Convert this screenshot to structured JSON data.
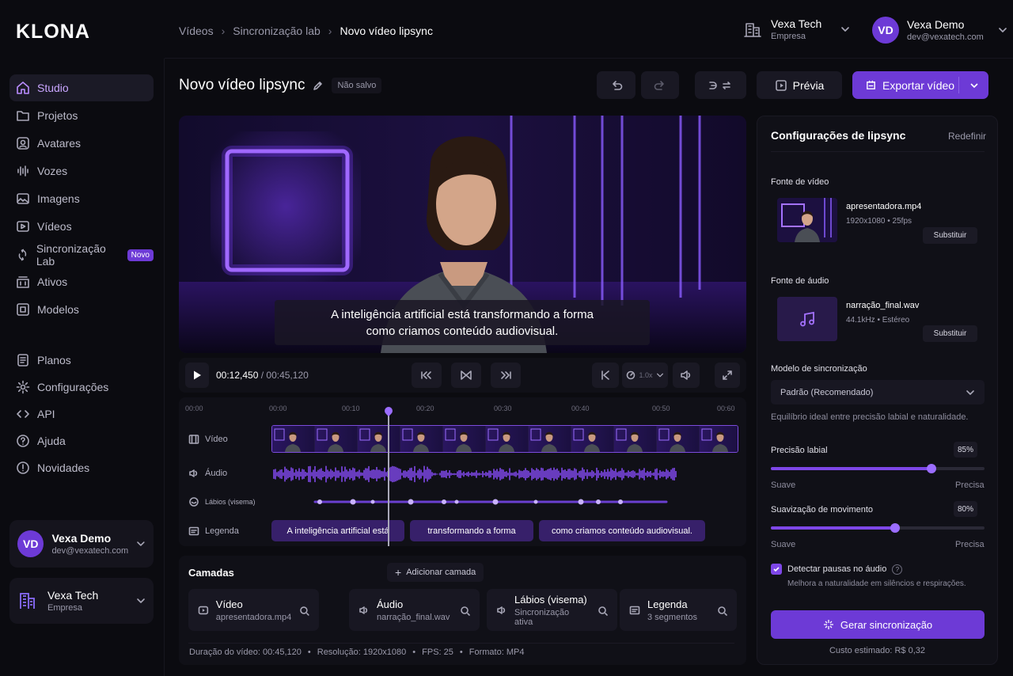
{
  "brand": {
    "logo": "KLONA"
  },
  "breadcrumb": {
    "items": [
      "Vídeos",
      "Sincronização lab"
    ],
    "current": "Novo vídeo lipsync"
  },
  "org": {
    "name": "Vexa Tech",
    "type": "Empresa"
  },
  "user": {
    "initials": "VD",
    "name": "Vexa Demo",
    "email": "dev@vexatech.com"
  },
  "sidebar": {
    "items": [
      {
        "label": "Studio",
        "icon": "home-icon"
      },
      {
        "label": "Projetos",
        "icon": "folder-icon"
      },
      {
        "label": "Avatares",
        "icon": "avatar-icon"
      },
      {
        "label": "Vozes",
        "icon": "voice-icon"
      },
      {
        "label": "Imagens",
        "icon": "image-icon"
      },
      {
        "label": "Vídeos",
        "icon": "video-icon"
      },
      {
        "label": "Sincronização Lab",
        "icon": "sync-icon",
        "badge": "Novo"
      },
      {
        "label": "Ativos",
        "icon": "assets-icon"
      },
      {
        "label": "Modelos",
        "icon": "models-icon"
      }
    ],
    "secondary": [
      {
        "label": "Planos",
        "icon": "plans-icon"
      },
      {
        "label": "Configurações",
        "icon": "gear-icon"
      },
      {
        "label": "API",
        "icon": "api-icon"
      },
      {
        "label": "Ajuda",
        "icon": "help-icon"
      },
      {
        "label": "Novidades",
        "icon": "news-icon"
      }
    ]
  },
  "project": {
    "title": "Novo vídeo lipsync",
    "status": "Não salvo"
  },
  "toolbar": {
    "preview_label": "Prévia",
    "export_label": "Exportar vídeo"
  },
  "preview": {
    "subtitle_line1": "A inteligência artificial está transformando a forma",
    "subtitle_line2": "como criamos conteúdo audiovisual."
  },
  "player": {
    "current_time": "00:12,450",
    "total_time": "00:45,120",
    "speed": "1.0x"
  },
  "timeline": {
    "ticks": [
      "00:00",
      "00:00",
      "00:10",
      "00:20",
      "00:30",
      "00:40",
      "00:50",
      "00:60"
    ],
    "tracks": [
      "Vídeo",
      "Áudio",
      "Lábios (visema)",
      "Legenda"
    ],
    "playhead_fraction": 0.25,
    "captions": [
      "A inteligência artificial está",
      "transformando a forma",
      "como criamos conteúdo audiovisual."
    ]
  },
  "layers": {
    "title": "Camadas",
    "add_label": "Adicionar camada",
    "cards": [
      {
        "title": "Vídeo",
        "sub": "apresentadora.mp4",
        "icon": "video-icon"
      },
      {
        "title": "Áudio",
        "sub": "narração_final.wav",
        "icon": "audio-icon"
      },
      {
        "title": "Lábios (visema)",
        "sub": "Sincronização ativa",
        "icon": "lips-icon"
      },
      {
        "title": "Legenda",
        "sub": "3 segmentos",
        "icon": "caption-icon"
      }
    ],
    "footer": {
      "duration": "Duração do vídeo: 00:45,120",
      "resolution": "Resolução: 1920x1080",
      "fps": "FPS: 25",
      "format": "Formato: MP4"
    }
  },
  "settings": {
    "title": "Configurações de lipsync",
    "reset_label": "Redefinir",
    "video_source_label": "Fonte de vídeo",
    "video_file": "apresentadora.mp4",
    "video_meta": "1920x1080 • 25fps",
    "replace_label": "Substituir",
    "audio_source_label": "Fonte de áudio",
    "audio_file": "narração_final.wav",
    "audio_meta": "44.1kHz • Estéreo",
    "model_label": "Modelo de sincronização",
    "model_value": "Padrão (Recomendado)",
    "model_desc": "Equilíbrio ideal entre precisão labial e naturalidade.",
    "lip_label": "Precisão labial",
    "lip_value": "85%",
    "lip_fraction": 0.75,
    "smooth_label": "Suavização de movimento",
    "smooth_value": "80%",
    "smooth_fraction": 0.58,
    "scale_min": "Suave",
    "scale_max": "Precisa",
    "pause_label": "Detectar pausas no áudio",
    "pause_checked": true,
    "pause_desc": "Melhora a naturalidade em silêncios e respirações.",
    "generate_label": "Gerar sincronização",
    "cost": "Custo estimado: R$ 0,32"
  },
  "colors": {
    "accent": "#6d3ad6",
    "accent_light": "#9b6dff",
    "bg": "#0b0b10",
    "panel": "#101017"
  }
}
